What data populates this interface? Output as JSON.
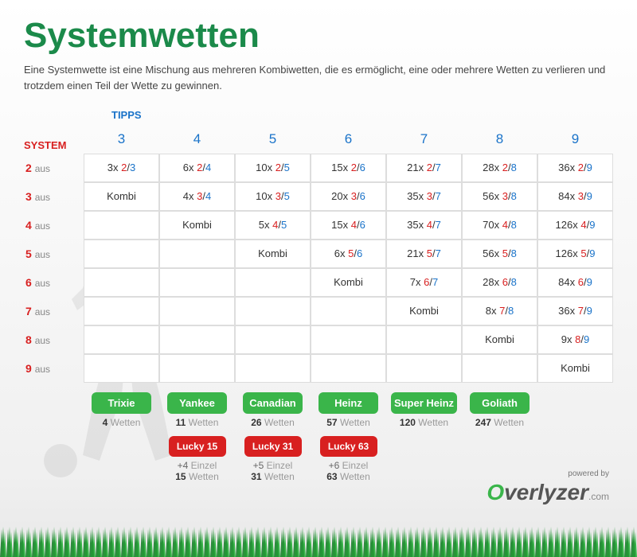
{
  "title": "Systemwetten",
  "subtitle": "Eine Systemwette ist eine Mischung aus mehreren Kombiwetten, die es ermöglicht,\neine oder mehrere Wetten zu verlieren und trotzdem einen Teil der Wette zu gewinnen.",
  "labels": {
    "tipps": "TIPPS",
    "system": "SYSTEM",
    "aus": "aus",
    "kombi": "Kombi",
    "wetten": "Wetten",
    "einzel": "Einzel"
  },
  "columns": [
    "3",
    "4",
    "5",
    "6",
    "7",
    "8",
    "9"
  ],
  "rows": [
    "2",
    "3",
    "4",
    "5",
    "6",
    "7",
    "8",
    "9"
  ],
  "cells": {
    "r2": [
      {
        "m": "3",
        "n": "2",
        "d": "3"
      },
      {
        "m": "6",
        "n": "2",
        "d": "4"
      },
      {
        "m": "10",
        "n": "2",
        "d": "5"
      },
      {
        "m": "15",
        "n": "2",
        "d": "6"
      },
      {
        "m": "21",
        "n": "2",
        "d": "7"
      },
      {
        "m": "28",
        "n": "2",
        "d": "8"
      },
      {
        "m": "36",
        "n": "2",
        "d": "9"
      }
    ],
    "r3": [
      {
        "kombi": true
      },
      {
        "m": "4",
        "n": "3",
        "d": "4"
      },
      {
        "m": "10",
        "n": "3",
        "d": "5"
      },
      {
        "m": "20",
        "n": "3",
        "d": "6"
      },
      {
        "m": "35",
        "n": "3",
        "d": "7"
      },
      {
        "m": "56",
        "n": "3",
        "d": "8"
      },
      {
        "m": "84",
        "n": "3",
        "d": "9"
      }
    ],
    "r4": [
      null,
      {
        "kombi": true
      },
      {
        "m": "5",
        "n": "4",
        "d": "5"
      },
      {
        "m": "15",
        "n": "4",
        "d": "6"
      },
      {
        "m": "35",
        "n": "4",
        "d": "7"
      },
      {
        "m": "70",
        "n": "4",
        "d": "8"
      },
      {
        "m": "126",
        "n": "4",
        "d": "9"
      }
    ],
    "r5": [
      null,
      null,
      {
        "kombi": true
      },
      {
        "m": "6",
        "n": "5",
        "d": "6"
      },
      {
        "m": "21",
        "n": "5",
        "d": "7"
      },
      {
        "m": "56",
        "n": "5",
        "d": "8"
      },
      {
        "m": "126",
        "n": "5",
        "d": "9"
      }
    ],
    "r6": [
      null,
      null,
      null,
      {
        "kombi": true
      },
      {
        "m": "7",
        "n": "6",
        "d": "7"
      },
      {
        "m": "28",
        "n": "6",
        "d": "8"
      },
      {
        "m": "84",
        "n": "6",
        "d": "9"
      }
    ],
    "r7": [
      null,
      null,
      null,
      null,
      {
        "kombi": true
      },
      {
        "m": "8",
        "n": "7",
        "d": "8"
      },
      {
        "m": "36",
        "n": "7",
        "d": "9"
      }
    ],
    "r8": [
      null,
      null,
      null,
      null,
      null,
      {
        "kombi": true
      },
      {
        "m": "9",
        "n": "8",
        "d": "9"
      }
    ],
    "r9": [
      null,
      null,
      null,
      null,
      null,
      null,
      {
        "kombi": true
      }
    ]
  },
  "green_badges": [
    {
      "name": "Trixie",
      "bets": "4"
    },
    {
      "name": "Yankee",
      "bets": "11"
    },
    {
      "name": "Canadian",
      "bets": "26"
    },
    {
      "name": "Heinz",
      "bets": "57"
    },
    {
      "name": "Super Heinz",
      "bets": "120"
    },
    {
      "name": "Goliath",
      "bets": "247"
    }
  ],
  "red_badges": [
    {
      "name": "Lucky 15",
      "einzel": "+4",
      "bets": "15"
    },
    {
      "name": "Lucky 31",
      "einzel": "+5",
      "bets": "31"
    },
    {
      "name": "Lucky 63",
      "einzel": "+6",
      "bets": "63"
    }
  ],
  "logo": {
    "powered": "powered by",
    "brand": "Overlyzer",
    "suffix": ".com"
  }
}
